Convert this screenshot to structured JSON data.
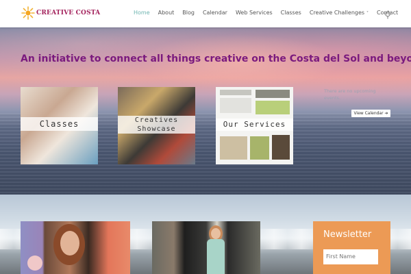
{
  "header": {
    "logo_text": "CREATIVE COSTA",
    "nav": [
      {
        "label": "Home",
        "active": true
      },
      {
        "label": "About",
        "active": false
      },
      {
        "label": "Blog",
        "active": false
      },
      {
        "label": "Calendar",
        "active": false
      },
      {
        "label": "Web Services",
        "active": false
      },
      {
        "label": "Classes",
        "active": false
      },
      {
        "label": "Creative Challenges",
        "active": false,
        "has_dropdown": true
      },
      {
        "label": "Contact",
        "active": false
      }
    ],
    "search_icon": "search-icon"
  },
  "hero": {
    "tagline": "An initiative to connect all things creative on the Costa del Sol and beyond....",
    "cards": [
      {
        "label": "Classes"
      },
      {
        "label_line1": "Creatives",
        "label_line2": "Showcase"
      },
      {
        "label": "Our Services"
      }
    ],
    "events": {
      "empty_text": "There are no upcoming events.",
      "button_label": "View Calendar",
      "button_icon": "arrow-right-icon"
    }
  },
  "newsletter": {
    "title": "Newsletter",
    "first_name_placeholder": "First Name"
  },
  "colors": {
    "tagline": "#7a1a7e",
    "nav_active": "#6fb5b1",
    "newsletter_bg": "#ec9a55",
    "logo": "#a3225c"
  }
}
